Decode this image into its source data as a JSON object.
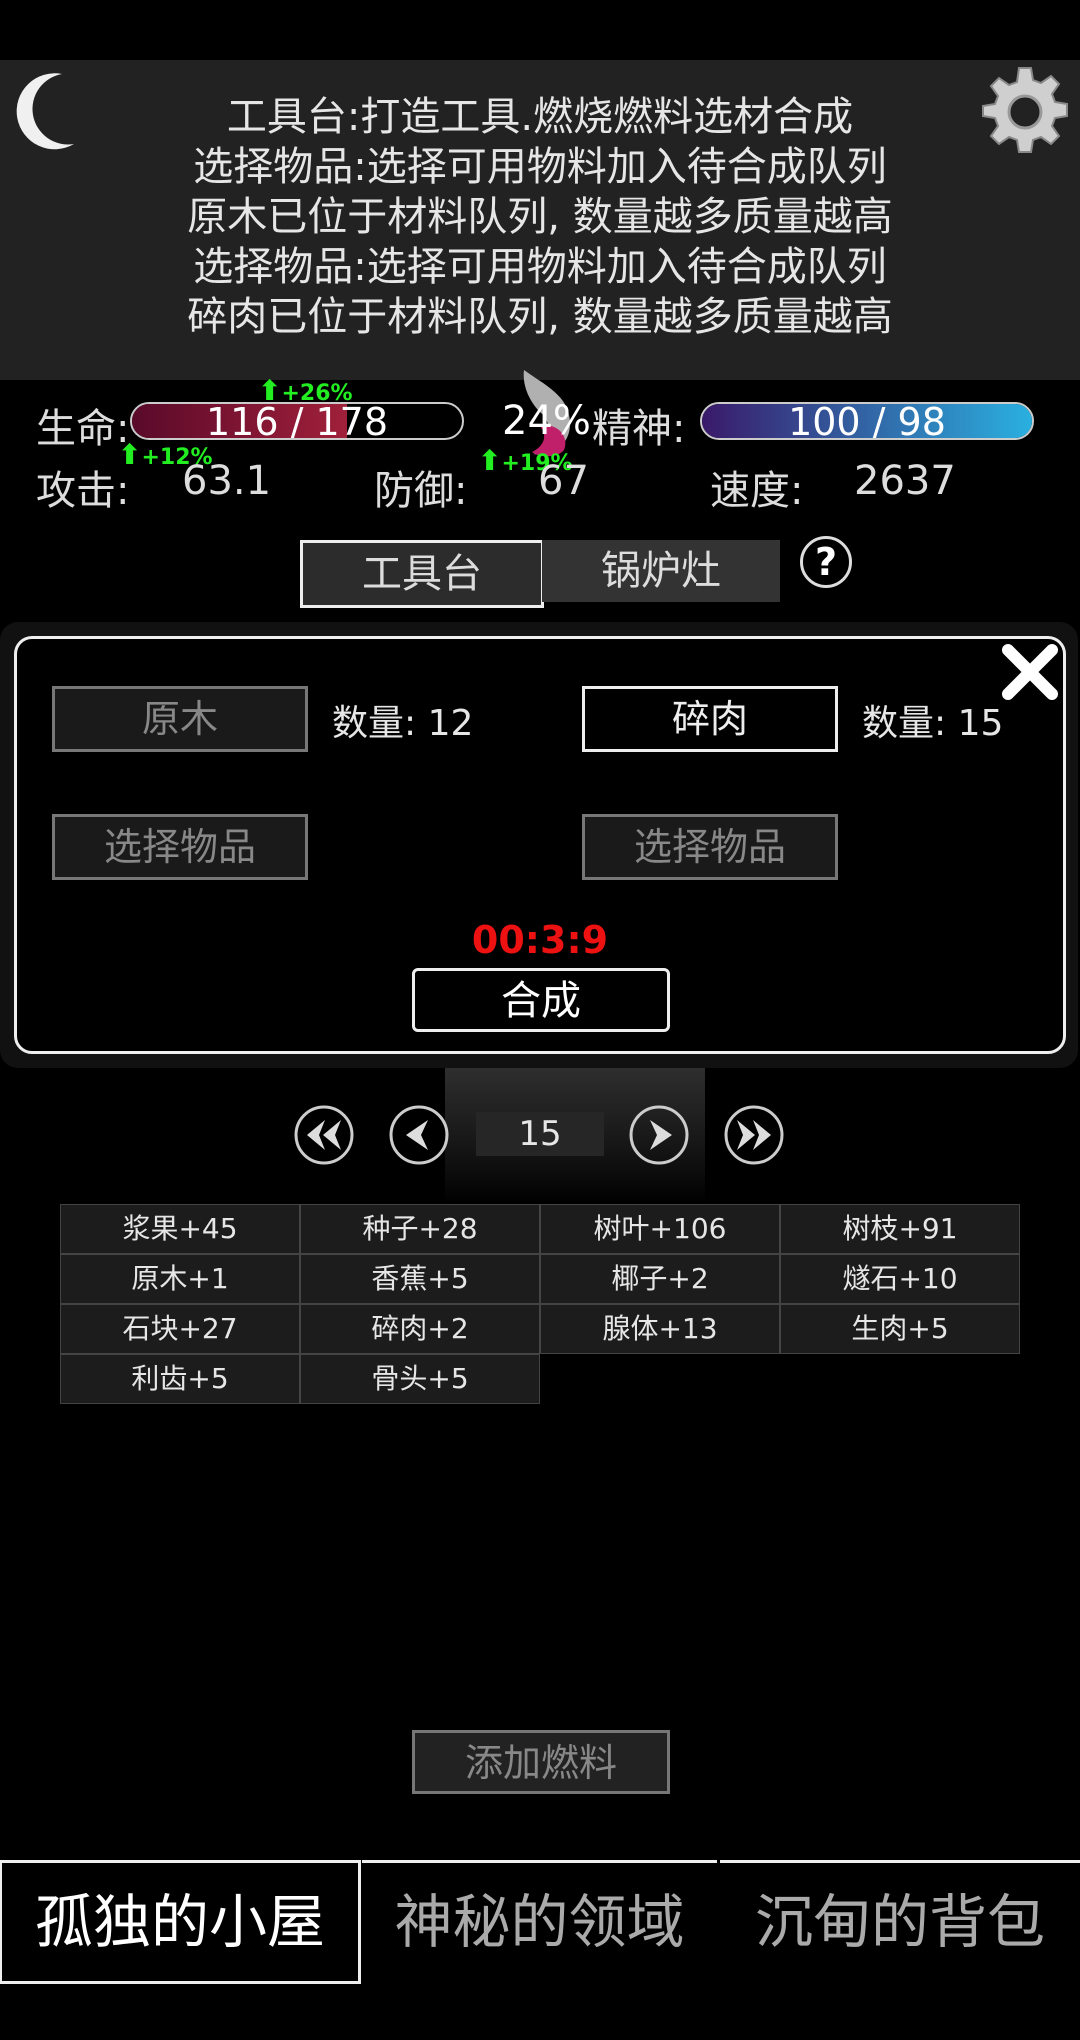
{
  "log": {
    "lines": [
      "工具台:打造工具.燃烧燃料选材合成",
      "选择物品:选择可用物料加入待合成队列",
      "原木已位于材料队列, 数量越多质量越高",
      "选择物品:选择可用物料加入待合成队列",
      "碎肉已位于材料队列, 数量越多质量越高"
    ]
  },
  "stats": {
    "life_label": "生命:",
    "life_value": "116 / 178",
    "life_fraction": 0.652,
    "life_bonus": "+26%",
    "percent": "24%",
    "spirit_label": "精神:",
    "spirit_value": "100 / 98",
    "spirit_fraction": 1.0,
    "attack_label": "攻击:",
    "attack_value": "63.1",
    "attack_bonus": "+12%",
    "defense_label": "防御:",
    "defense_value": "67",
    "defense_bonus": "+19%",
    "speed_label": "速度:",
    "speed_value": "2637"
  },
  "tabs": {
    "workbench": "工具台",
    "furnace": "锅炉灶",
    "help": "?"
  },
  "craft": {
    "slot1": "原木",
    "slot1_qty": "数量: 12",
    "slot2": "碎肉",
    "slot2_qty": "数量: 15",
    "slot3": "选择物品",
    "slot4": "选择物品",
    "timer": "00:3:9",
    "synthesize": "合成"
  },
  "pager": {
    "page": "15"
  },
  "items": [
    "浆果+45",
    "种子+28",
    "树叶+106",
    "树枝+91",
    "原木+1",
    "香蕉+5",
    "椰子+2",
    "燧石+10",
    "石块+27",
    "碎肉+2",
    "腺体+13",
    "生肉+5",
    "利齿+5",
    "骨头+5"
  ],
  "add_fuel": "添加燃料",
  "nav": {
    "cabin": "孤独的小屋",
    "realm": "神秘的领域",
    "bag": "沉甸的背包"
  },
  "colors": {
    "life_bar": "#8a1a3a",
    "spirit_bar_start": "#3a1a6a",
    "spirit_bar_end": "#2ab0e0",
    "timer": "#ee1111",
    "bonus": "#22ee22"
  }
}
